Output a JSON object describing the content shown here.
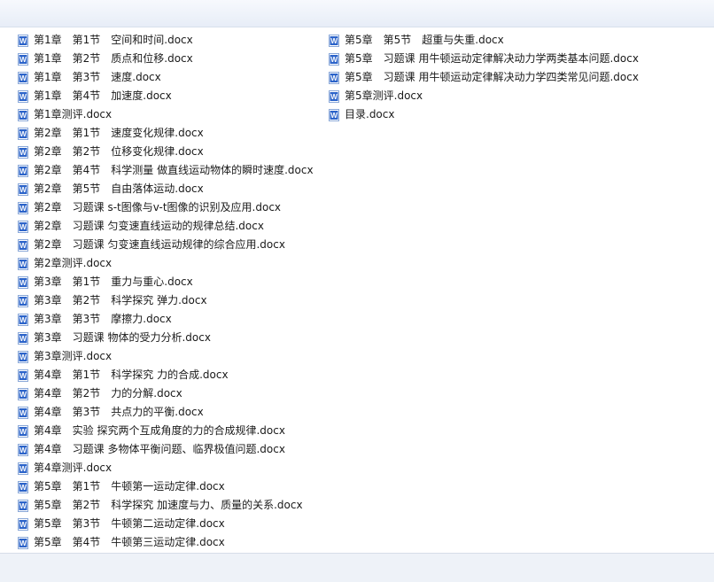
{
  "files_left": [
    {
      "name": "第1章　第1节　空间和时间.docx",
      "icon": "word-doc-icon"
    },
    {
      "name": "第1章　第2节　质点和位移.docx",
      "icon": "word-doc-icon"
    },
    {
      "name": "第1章　第3节　速度.docx",
      "icon": "word-doc-icon"
    },
    {
      "name": "第1章　第4节　加速度.docx",
      "icon": "word-doc-icon"
    },
    {
      "name": "第1章测评.docx",
      "icon": "word-doc-icon"
    },
    {
      "name": "第2章　第1节　速度变化规律.docx",
      "icon": "word-doc-icon"
    },
    {
      "name": "第2章　第2节　位移变化规律.docx",
      "icon": "word-doc-icon"
    },
    {
      "name": "第2章　第4节　科学测量 做直线运动物体的瞬时速度.docx",
      "icon": "word-doc-icon"
    },
    {
      "name": "第2章　第5节　自由落体运动.docx",
      "icon": "word-doc-icon"
    },
    {
      "name": "第2章　习题课 s-t图像与v-t图像的识别及应用.docx",
      "icon": "word-doc-icon"
    },
    {
      "name": "第2章　习题课 匀变速直线运动的规律总结.docx",
      "icon": "word-doc-icon"
    },
    {
      "name": "第2章　习题课 匀变速直线运动规律的综合应用.docx",
      "icon": "word-doc-icon"
    },
    {
      "name": "第2章测评.docx",
      "icon": "word-doc-icon"
    },
    {
      "name": "第3章　第1节　重力与重心.docx",
      "icon": "word-doc-icon"
    },
    {
      "name": "第3章　第2节　科学探究 弹力.docx",
      "icon": "word-doc-icon"
    },
    {
      "name": "第3章　第3节　摩擦力.docx",
      "icon": "word-doc-icon"
    },
    {
      "name": "第3章　习题课 物体的受力分析.docx",
      "icon": "word-doc-icon"
    },
    {
      "name": "第3章测评.docx",
      "icon": "word-doc-icon"
    },
    {
      "name": "第4章　第1节　科学探究 力的合成.docx",
      "icon": "word-doc-icon"
    },
    {
      "name": "第4章　第2节　力的分解.docx",
      "icon": "word-doc-icon"
    },
    {
      "name": "第4章　第3节　共点力的平衡.docx",
      "icon": "word-doc-icon"
    },
    {
      "name": "第4章　实验 探究两个互成角度的力的合成规律.docx",
      "icon": "word-doc-icon"
    },
    {
      "name": "第4章　习题课 多物体平衡问题、临界极值问题.docx",
      "icon": "word-doc-icon"
    },
    {
      "name": "第4章测评.docx",
      "icon": "word-doc-icon"
    },
    {
      "name": "第5章　第1节　牛顿第一运动定律.docx",
      "icon": "word-doc-icon"
    },
    {
      "name": "第5章　第2节　科学探究 加速度与力、质量的关系.docx",
      "icon": "word-doc-icon"
    },
    {
      "name": "第5章　第3节　牛顿第二运动定律.docx",
      "icon": "word-doc-icon"
    },
    {
      "name": "第5章　第4节　牛顿第三运动定律.docx",
      "icon": "word-doc-icon"
    }
  ],
  "files_right": [
    {
      "name": "第5章　第5节　超重与失重.docx",
      "icon": "word-doc-icon"
    },
    {
      "name": "第5章　习题课 用牛顿运动定律解决动力学两类基本问题.docx",
      "icon": "word-doc-icon"
    },
    {
      "name": "第5章　习题课 用牛顿运动定律解决动力学四类常见问题.docx",
      "icon": "word-doc-icon"
    },
    {
      "name": "第5章测评.docx",
      "icon": "word-doc-icon"
    },
    {
      "name": "目录.docx",
      "icon": "word-doc-icon"
    }
  ],
  "colors": {
    "icon_blue": "#2b63c9",
    "icon_border": "#8aa8d8",
    "text": "#1a1a1a"
  }
}
